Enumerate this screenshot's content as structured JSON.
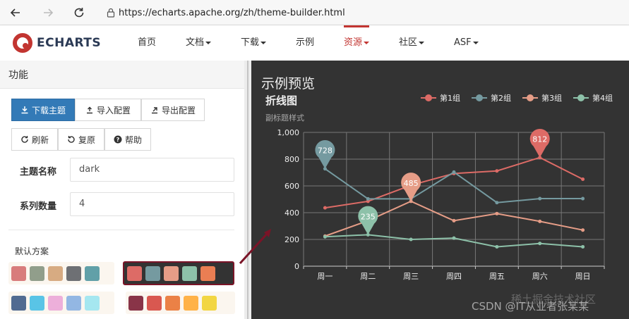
{
  "browser": {
    "url": "https://echarts.apache.org/zh/theme-builder.html"
  },
  "header": {
    "logo_text": "ECHARTS",
    "nav": [
      {
        "label": "首页",
        "dropdown": false,
        "active": false
      },
      {
        "label": "文档",
        "dropdown": true,
        "active": false
      },
      {
        "label": "下载",
        "dropdown": true,
        "active": false
      },
      {
        "label": "示例",
        "dropdown": false,
        "active": false
      },
      {
        "label": "资源",
        "dropdown": true,
        "active": true
      },
      {
        "label": "社区",
        "dropdown": true,
        "active": false
      },
      {
        "label": "ASF",
        "dropdown": true,
        "active": false
      }
    ]
  },
  "left_panel": {
    "title": "功能",
    "buttons_row1": [
      {
        "label": "下载主题",
        "icon": "download-icon"
      },
      {
        "label": "导入配置",
        "icon": "import-icon"
      },
      {
        "label": "导出配置",
        "icon": "export-icon"
      }
    ],
    "buttons_row2": [
      {
        "label": "刷新",
        "icon": "refresh-icon"
      },
      {
        "label": "复原",
        "icon": "undo-icon"
      },
      {
        "label": "帮助",
        "icon": "help-icon"
      }
    ],
    "theme_name_label": "主题名称",
    "theme_name_value": "dark",
    "series_count_label": "系列数量",
    "series_count_value": "4",
    "default_scheme_label": "默认方案",
    "schemes": [
      [
        "#d87c7c",
        "#919e8b",
        "#d7ab82",
        "#6e7074",
        "#61a0a8"
      ],
      [
        "#dd6b66",
        "#759aa0",
        "#e69d87",
        "#8dc1a9",
        "#ea7e53"
      ],
      [
        "#516b91",
        "#59c4e6",
        "#edafda",
        "#93b7e3",
        "#a5e7f0"
      ],
      [
        "#893448",
        "#d95850",
        "#eb8146",
        "#ffb248",
        "#f2d643"
      ]
    ],
    "selected_scheme_index": 1
  },
  "preview": {
    "title": "示例预览",
    "watermarks": [
      "稀土掘金技术社区",
      "CSDN @IT从业者张某某"
    ]
  },
  "chart_data": {
    "type": "line",
    "title": "折线图",
    "subtitle": "副标题样式",
    "categories": [
      "周一",
      "周二",
      "周三",
      "周四",
      "周五",
      "周六",
      "周日"
    ],
    "ylim": [
      0,
      1000
    ],
    "yticks": [
      "0",
      "200",
      "400",
      "600",
      "800",
      "1,000"
    ],
    "grid": true,
    "legend_position": "top-right",
    "series": [
      {
        "name": "第1组",
        "color": "#dd6b66",
        "values": [
          436,
          485,
          605,
          693,
          712,
          812,
          650
        ]
      },
      {
        "name": "第2组",
        "color": "#759aa0",
        "values": [
          728,
          503,
          503,
          703,
          475,
          505,
          505
        ]
      },
      {
        "name": "第3组",
        "color": "#e69d87",
        "values": [
          225,
          340,
          485,
          340,
          393,
          335,
          270
        ]
      },
      {
        "name": "第4组",
        "color": "#8dc1a9",
        "values": [
          220,
          235,
          200,
          210,
          145,
          170,
          145
        ]
      }
    ],
    "markers": [
      {
        "series": 1,
        "index": 0,
        "label": "728"
      },
      {
        "series": 3,
        "index": 1,
        "label": "235"
      },
      {
        "series": 2,
        "index": 2,
        "label": "485"
      },
      {
        "series": 0,
        "index": 5,
        "label": "812"
      }
    ]
  }
}
